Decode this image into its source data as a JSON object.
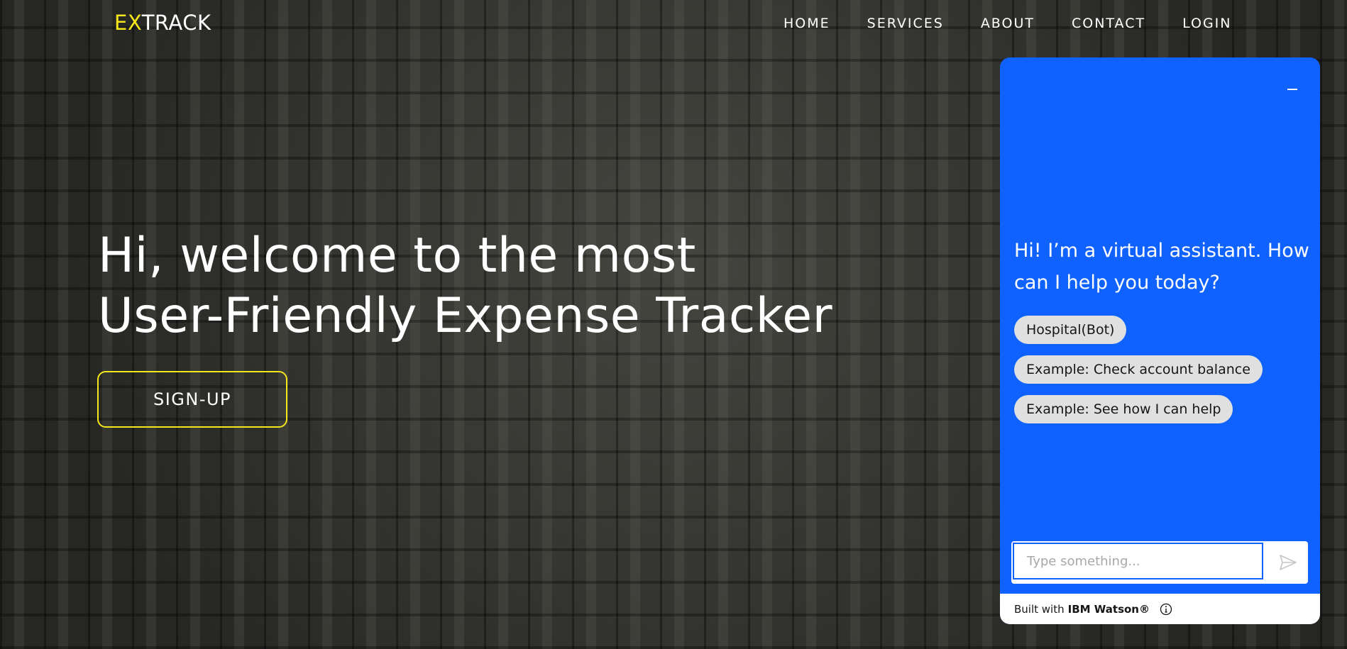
{
  "nav": {
    "logo_accent": "EX",
    "logo_rest": "TRACK",
    "items": [
      "HOME",
      "SERVICES",
      "ABOUT",
      "CONTACT",
      "LOGIN"
    ]
  },
  "hero": {
    "title_line1": "Hi, welcome to the most",
    "title_line2": "User-Friendly Expense Tracker",
    "signup_label": "SIGN-UP"
  },
  "chat": {
    "greeting": "Hi! I’m a virtual assistant. How can I help you today?",
    "suggestions": [
      "Hospital(Bot)",
      "Example: Check account balance",
      "Example: See how I can help"
    ],
    "input_placeholder": "Type something...",
    "footer_prefix": "Built with",
    "footer_brand": "IBM Watson®"
  },
  "colors": {
    "accent_yellow": "#f5e71c",
    "chat_blue": "#0f62fe"
  }
}
